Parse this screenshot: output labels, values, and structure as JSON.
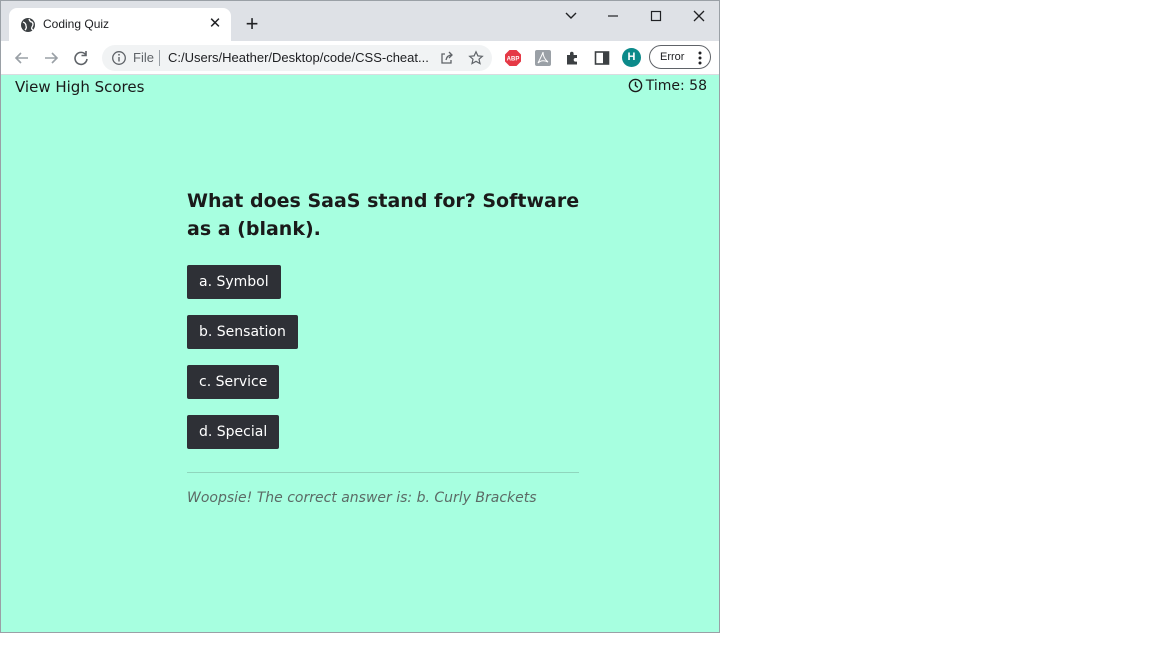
{
  "browser": {
    "tab_title": "Coding Quiz",
    "tab_close": "✕",
    "new_tab": "+",
    "url_scheme_label": "File",
    "url": "C:/Users/Heather/Desktop/code/CSS-cheat...",
    "profile_initial": "H",
    "error_label": "Error"
  },
  "page": {
    "high_scores_label": "View High Scores",
    "timer_label": "Time: 58",
    "question": "What does SaaS stand for? Software as a (blank).",
    "answers": [
      {
        "label": "a. Symbol"
      },
      {
        "label": "b. Sensation"
      },
      {
        "label": "c. Service"
      },
      {
        "label": "d. Special"
      }
    ],
    "feedback": "Woopsie! The correct answer is: b. Curly Brackets"
  },
  "colors": {
    "page_background": "#a7ffe0",
    "button_background": "#2e3036",
    "button_text": "#ffffff"
  }
}
